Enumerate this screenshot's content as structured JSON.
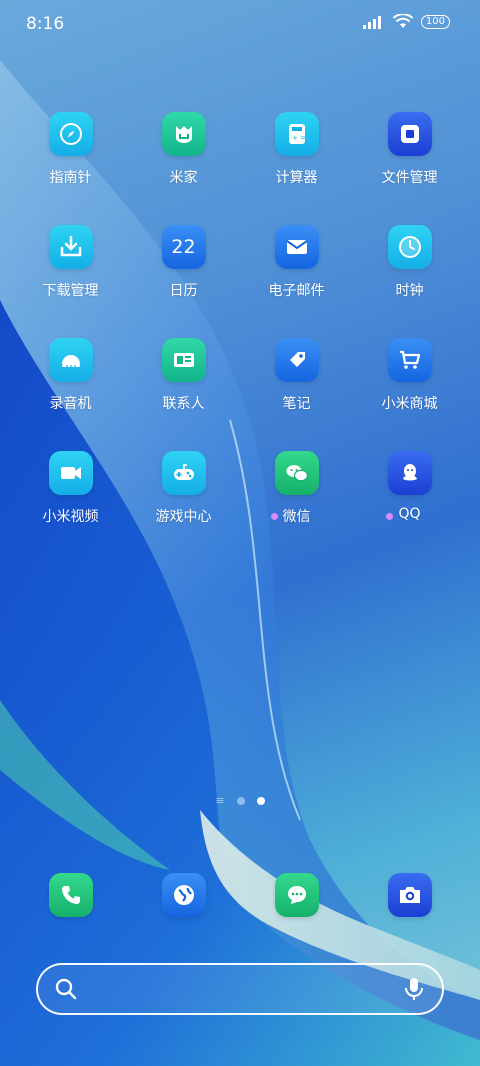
{
  "status_bar": {
    "time": "8:16",
    "battery": "100",
    "icons": [
      "signal-icon",
      "wifi-icon",
      "battery-icon"
    ]
  },
  "apps": [
    {
      "label": "指南针",
      "icon": "compass-icon",
      "color": "cyan"
    },
    {
      "label": "米家",
      "icon": "mijia-icon",
      "color": "teal"
    },
    {
      "label": "计算器",
      "icon": "calculator-icon",
      "color": "cyan"
    },
    {
      "label": "文件管理",
      "icon": "file-manager-icon",
      "color": "indigo"
    },
    {
      "label": "下载管理",
      "icon": "download-icon",
      "color": "cyan"
    },
    {
      "label": "日历",
      "icon": "calendar-icon",
      "color": "blue",
      "icon_text": "22"
    },
    {
      "label": "电子邮件",
      "icon": "mail-icon",
      "color": "blue"
    },
    {
      "label": "时钟",
      "icon": "clock-icon",
      "color": "cyan"
    },
    {
      "label": "录音机",
      "icon": "recorder-icon",
      "color": "cyan"
    },
    {
      "label": "联系人",
      "icon": "contacts-icon",
      "color": "teal"
    },
    {
      "label": "笔记",
      "icon": "notes-icon",
      "color": "blue"
    },
    {
      "label": "小米商城",
      "icon": "store-cart-icon",
      "color": "blue"
    },
    {
      "label": "小米视频",
      "icon": "video-icon",
      "color": "cyan"
    },
    {
      "label": "游戏中心",
      "icon": "game-controller-icon",
      "color": "cyan"
    },
    {
      "label": "微信",
      "icon": "wechat-icon",
      "color": "green",
      "badge_dot": true
    },
    {
      "label": "QQ",
      "icon": "qq-icon",
      "color": "indigo",
      "badge_dot": true
    }
  ],
  "page_indicator": {
    "pages": 3,
    "active_index": 2
  },
  "dock": [
    {
      "icon": "phone-icon",
      "color": "green"
    },
    {
      "icon": "browser-globe-icon",
      "color": "blue"
    },
    {
      "icon": "messages-icon",
      "color": "green"
    },
    {
      "icon": "camera-icon",
      "color": "indigo"
    }
  ],
  "search": {
    "value": "",
    "placeholder": ""
  },
  "colors": {
    "accent": "#1f6fe0",
    "badge_dot": "#d58cff",
    "background": "#4f8fd6"
  }
}
